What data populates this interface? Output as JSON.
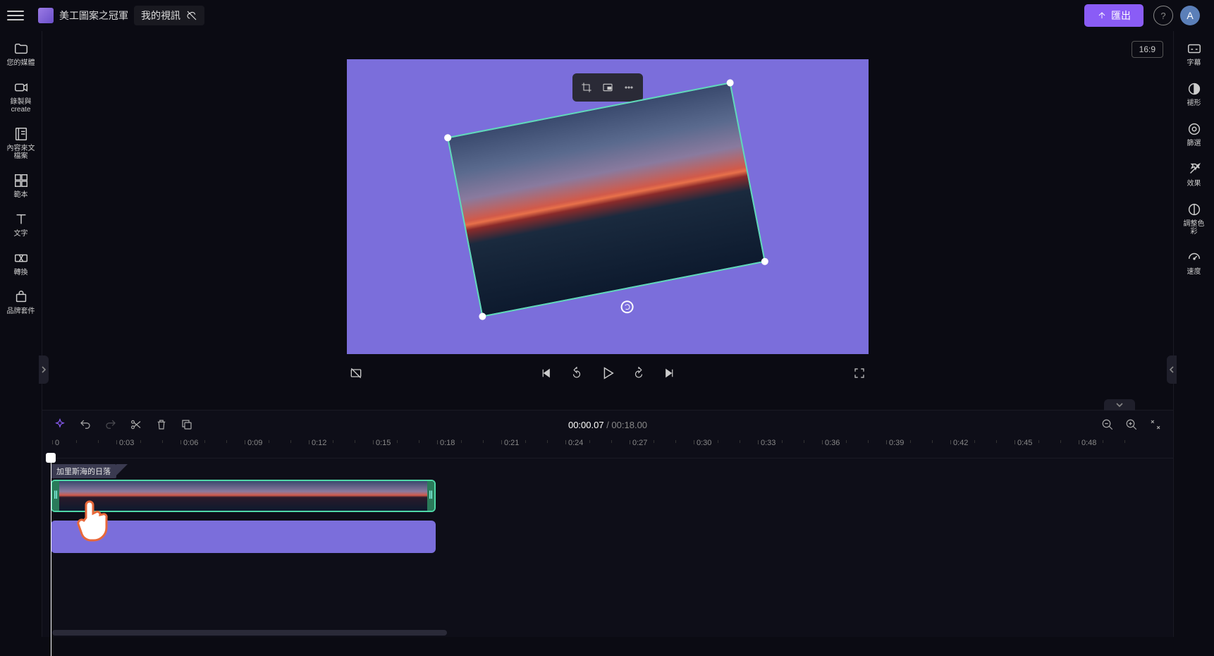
{
  "header": {
    "project_title": "美工圖案之冠軍",
    "project_sub": "我的視訊",
    "export_label": "匯出",
    "avatar_letter": "A",
    "aspect_ratio": "16:9"
  },
  "left_rail": [
    {
      "icon": "folder",
      "label": "您的媒體"
    },
    {
      "icon": "camera",
      "label": "錄製與\ncreate"
    },
    {
      "icon": "library",
      "label": "內容來文\n檔案"
    },
    {
      "icon": "templates",
      "label": "範本"
    },
    {
      "icon": "text",
      "label": "文字"
    },
    {
      "icon": "transitions",
      "label": "轉換"
    },
    {
      "icon": "brand",
      "label": "品牌套件"
    }
  ],
  "right_rail": [
    {
      "icon": "cc",
      "label": "字幕"
    },
    {
      "icon": "fade",
      "label": "褪形"
    },
    {
      "icon": "filter",
      "label": "篩選"
    },
    {
      "icon": "fx",
      "label": "效果"
    },
    {
      "icon": "adjust",
      "label": "調整色\n彩"
    },
    {
      "icon": "speed",
      "label": "速度"
    }
  ],
  "timeline": {
    "current_time": "00:00.07",
    "total_time": "00:18.00",
    "clip_name": "加里斯海的日落",
    "ticks": [
      "0",
      "0:03",
      "0:06",
      "0:09",
      "0:12",
      "0:15",
      "0:18",
      "0:21",
      "0:24",
      "0:27",
      "0:30",
      "0:33",
      "0:36",
      "0:39",
      "0:42",
      "0:45",
      "0:48"
    ]
  }
}
